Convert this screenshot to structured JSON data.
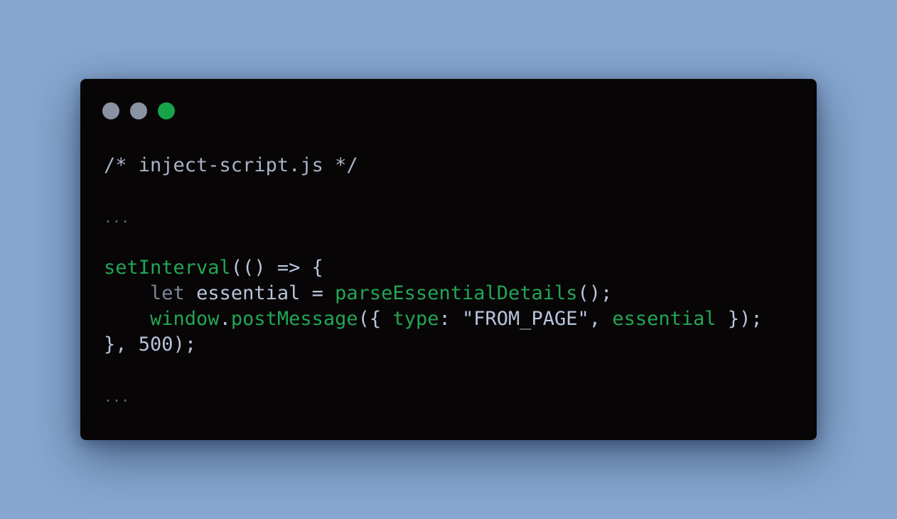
{
  "window": {
    "background": "#080506",
    "traffic_lights": [
      {
        "name": "close",
        "color": "#8892a2"
      },
      {
        "name": "minimize",
        "color": "#8892a2"
      },
      {
        "name": "maximize",
        "color": "#16a34a"
      }
    ]
  },
  "page_background": "#87a7d0",
  "code": {
    "comment": "/* inject-script.js */",
    "ellipsis_top": "...",
    "line_set_interval": {
      "fn": "setInterval",
      "rest": "(() => {"
    },
    "line_let": {
      "indent": "    ",
      "keyword": "let",
      "var": " essential = ",
      "fn": "parseEssentialDetails",
      "rest": "();"
    },
    "line_post": {
      "indent": "    ",
      "obj": "window",
      "dot": ".",
      "fn": "postMessage",
      "open": "({ ",
      "key": "type",
      "colon": ": ",
      "string": "\"FROM_PAGE\"",
      "comma": ", ",
      "shorthand": "essential",
      "close": " });"
    },
    "line_close": {
      "brace": "}, ",
      "number": "500",
      "rest": ");"
    },
    "ellipsis_bottom": "..."
  },
  "colors": {
    "function": "#22a655",
    "comment": "#a7b3c8",
    "keyword": "#7c8699",
    "text": "#b7c4db",
    "ellipsis": "#5f6878"
  }
}
